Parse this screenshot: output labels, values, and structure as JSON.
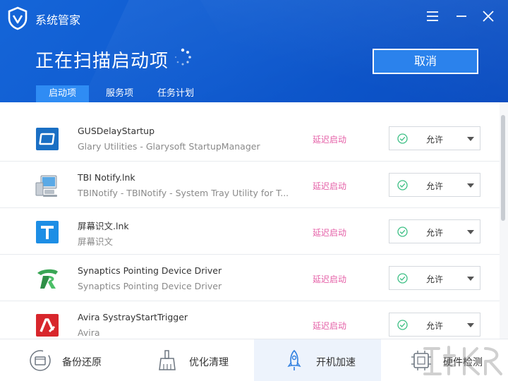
{
  "app": {
    "title": "系统管家",
    "icons": {
      "logo": "shield-v-icon",
      "menu": "menu-icon",
      "minimize": "minimize-icon",
      "close": "close-icon"
    }
  },
  "scan": {
    "title": "正在扫描启动项",
    "cancel_label": "取消"
  },
  "tabs": [
    {
      "label": "启动项",
      "active": true
    },
    {
      "label": "服务项",
      "active": false
    },
    {
      "label": "任务计划",
      "active": false
    }
  ],
  "items": [
    {
      "name": "GUSDelayStartup",
      "description": "Glary Utilities - Glarysoft StartupManager",
      "status": "延迟启动",
      "action": "允许",
      "icon": "glary-app-icon"
    },
    {
      "name": "TBI Notify.lnk",
      "description": "TBINotify - TBINotify - System Tray Utility for T...",
      "status": "延迟启动",
      "action": "允许",
      "icon": "computer-monitor-icon"
    },
    {
      "name": "屏幕识文.lnk",
      "description": "屏幕识文",
      "status": "延迟启动",
      "action": "允许",
      "icon": "t-letter-icon"
    },
    {
      "name": "Synaptics Pointing Device Driver",
      "description": "Synaptics Pointing Device Driver",
      "status": "延迟启动",
      "action": "允许",
      "icon": "synaptics-icon"
    },
    {
      "name": "Avira SystrayStartTrigger",
      "description": "Avira",
      "status": "延迟启动",
      "action": "允许",
      "icon": "avira-icon"
    }
  ],
  "bottom_nav": [
    {
      "label": "备份还原",
      "icon": "backup-restore-icon",
      "active": false
    },
    {
      "label": "优化清理",
      "icon": "broom-icon",
      "active": false
    },
    {
      "label": "开机加速",
      "icon": "rocket-icon",
      "active": true
    },
    {
      "label": "硬件检测",
      "icon": "chip-icon",
      "active": false
    }
  ],
  "colors": {
    "header_blue": "#0f5bd0",
    "tab_active": "#2f8cf4",
    "status_pink": "#e561a8",
    "check_green": "#3cbf84"
  }
}
